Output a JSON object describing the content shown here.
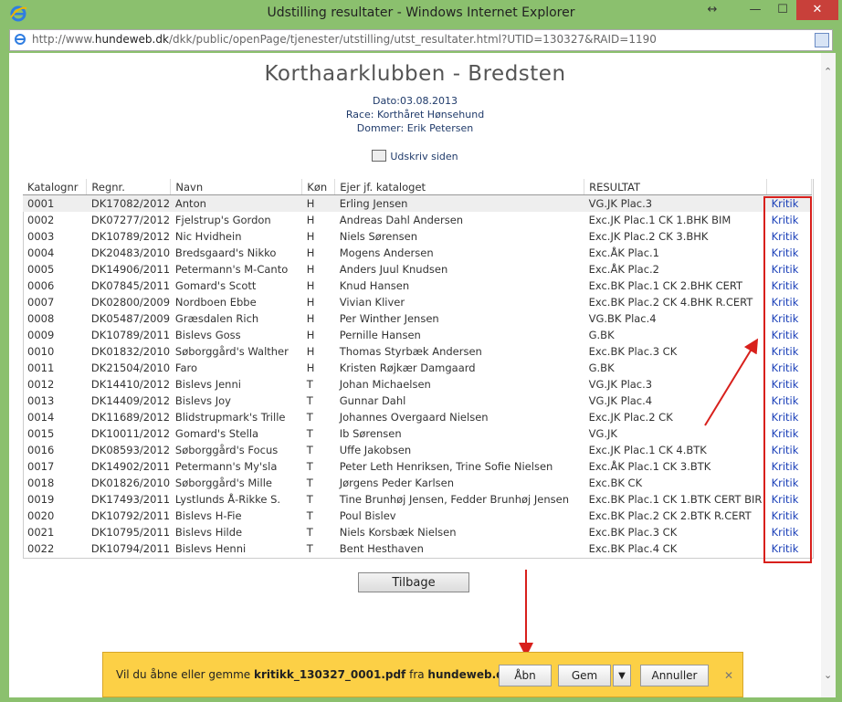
{
  "window": {
    "title": "Udstilling resultater - Windows Internet Explorer",
    "resize_glyph": "↔",
    "min_glyph": "—",
    "max_glyph": "☐",
    "close_glyph": "✕"
  },
  "address": {
    "url_pre": "http://www.",
    "url_domain": "hundeweb.dk",
    "url_post": "/dkk/public/openPage/tjenester/utstilling/utst_resultater.html?UTID=130327&RAID=1190"
  },
  "page": {
    "heading": "Korthaarklubben - Bredsten",
    "date_label": "Dato:",
    "date_value": "03.08.2013",
    "race_label": "Race: ",
    "race_value": "Korthåret Hønsehund",
    "judge_label": "Dommer: ",
    "judge_value": "Erik Petersen",
    "print_label": "Udskriv siden",
    "back_button": "Tilbage"
  },
  "table": {
    "headers": [
      "Katalognr",
      "Regnr.",
      "Navn",
      "Køn",
      "Ejer jf. kataloget",
      "RESULTAT",
      ""
    ],
    "rows": [
      [
        "0001",
        "DK17082/2012",
        "Anton",
        "H",
        "Erling Jensen",
        "VG.JK Plac.3",
        "Kritik"
      ],
      [
        "0002",
        "DK07277/2012",
        "Fjelstrup's Gordon",
        "H",
        "Andreas Dahl Andersen",
        "Exc.JK Plac.1 CK 1.BHK BIM",
        "Kritik"
      ],
      [
        "0003",
        "DK10789/2012",
        "Nic Hvidhein",
        "H",
        "Niels Sørensen",
        "Exc.JK Plac.2 CK 3.BHK",
        "Kritik"
      ],
      [
        "0004",
        "DK20483/2010",
        "Bredsgaard's Nikko",
        "H",
        "Mogens Andersen",
        "Exc.ÅK Plac.1",
        "Kritik"
      ],
      [
        "0005",
        "DK14906/2011",
        "Petermann's M-Canto",
        "H",
        "Anders Juul Knudsen",
        "Exc.ÅK Plac.2",
        "Kritik"
      ],
      [
        "0006",
        "DK07845/2011",
        "Gomard's Scott",
        "H",
        "Knud Hansen",
        "Exc.BK Plac.1 CK 2.BHK CERT",
        "Kritik"
      ],
      [
        "0007",
        "DK02800/2009",
        "Nordboen Ebbe",
        "H",
        "Vivian Kliver",
        "Exc.BK Plac.2 CK 4.BHK R.CERT",
        "Kritik"
      ],
      [
        "0008",
        "DK05487/2009",
        "Græsdalen Rich",
        "H",
        "Per Winther Jensen",
        "VG.BK Plac.4",
        "Kritik"
      ],
      [
        "0009",
        "DK10789/2011",
        "Bislevs Goss",
        "H",
        "Pernille Hansen",
        "G.BK",
        "Kritik"
      ],
      [
        "0010",
        "DK01832/2010",
        "Søborggård's Walther",
        "H",
        "Thomas Styrbæk Andersen",
        "Exc.BK Plac.3 CK",
        "Kritik"
      ],
      [
        "0011",
        "DK21504/2010",
        "Faro",
        "H",
        "Kristen Røjkær Damgaard",
        "G.BK",
        "Kritik"
      ],
      [
        "0012",
        "DK14410/2012",
        "Bislevs Jenni",
        "T",
        "Johan Michaelsen",
        "VG.JK Plac.3",
        "Kritik"
      ],
      [
        "0013",
        "DK14409/2012",
        "Bislevs Joy",
        "T",
        "Gunnar Dahl",
        "VG.JK Plac.4",
        "Kritik"
      ],
      [
        "0014",
        "DK11689/2012",
        "Blidstrupmark's Trille",
        "T",
        "Johannes Overgaard Nielsen",
        "Exc.JK Plac.2 CK",
        "Kritik"
      ],
      [
        "0015",
        "DK10011/2012",
        "Gomard's Stella",
        "T",
        "Ib Sørensen",
        "VG.JK",
        "Kritik"
      ],
      [
        "0016",
        "DK08593/2012",
        "Søborggård's Focus",
        "T",
        "Uffe Jakobsen",
        "Exc.JK Plac.1 CK 4.BTK",
        "Kritik"
      ],
      [
        "0017",
        "DK14902/2011",
        "Petermann's My'sla",
        "T",
        "Peter Leth Henriksen, Trine Sofie Nielsen",
        "Exc.ÅK Plac.1 CK 3.BTK",
        "Kritik"
      ],
      [
        "0018",
        "DK01826/2010",
        "Søborggård's Mille",
        "T",
        "Jørgens Peder Karlsen",
        "Exc.BK CK",
        "Kritik"
      ],
      [
        "0019",
        "DK17493/2011",
        "Lystlunds Å-Rikke S.",
        "T",
        "Tine Brunhøj Jensen, Fedder Brunhøj Jensen",
        "Exc.BK Plac.1 CK 1.BTK CERT BIR",
        "Kritik"
      ],
      [
        "0020",
        "DK10792/2011",
        "Bislevs H-Fie",
        "T",
        "Poul Bislev",
        "Exc.BK Plac.2 CK 2.BTK R.CERT",
        "Kritik"
      ],
      [
        "0021",
        "DK10795/2011",
        "Bislevs Hilde",
        "T",
        "Niels Korsbæk Nielsen",
        "Exc.BK Plac.3 CK",
        "Kritik"
      ],
      [
        "0022",
        "DK10794/2011",
        "Bislevs Henni",
        "T",
        "Bent Hesthaven",
        "Exc.BK Plac.4 CK",
        "Kritik"
      ]
    ]
  },
  "notification": {
    "pre": "Vil du åbne eller gemme ",
    "filename": "kritikk_130327_0001.pdf",
    "mid": " fra ",
    "site": "hundeweb.dk",
    "post": "?",
    "open": "Åbn",
    "save": "Gem",
    "drop": "▼",
    "cancel": "Annuller",
    "close": "✕"
  },
  "colors": {
    "highlight": "#d8201c",
    "link": "#1a3fb8",
    "notification_bar": "#fcd046"
  }
}
